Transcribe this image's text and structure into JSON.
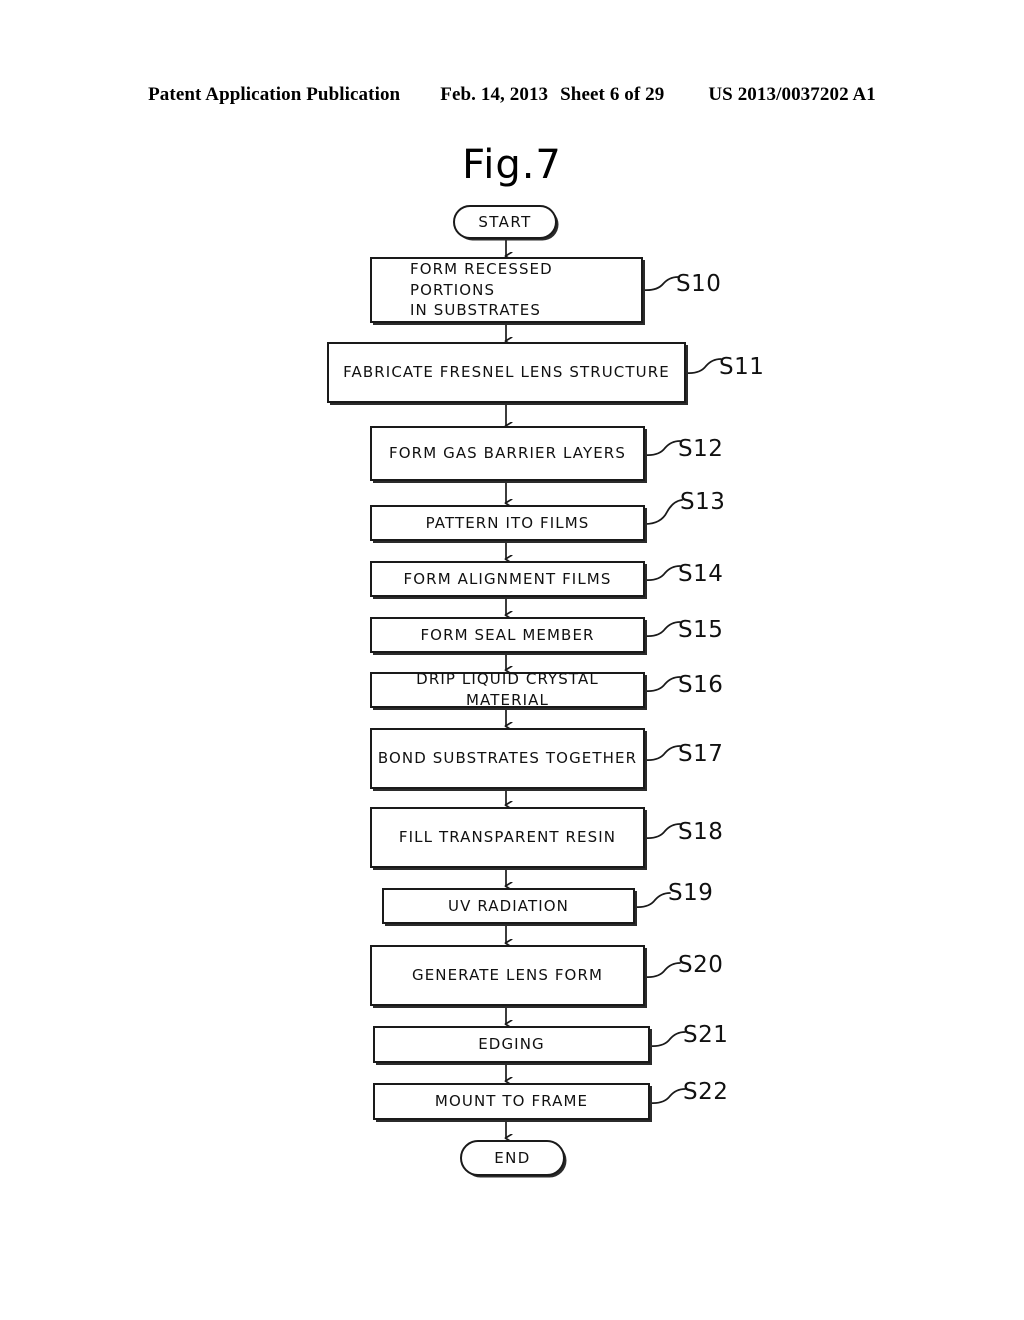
{
  "header": {
    "publication": "Patent Application Publication",
    "date": "Feb. 14, 2013",
    "sheet": "Sheet 6 of 29",
    "patent_number": "US 2013/0037202 A1"
  },
  "figure": {
    "title": "Fig.7"
  },
  "flowchart": {
    "start_label": "START",
    "end_label": "END",
    "steps": [
      {
        "ref": "S10",
        "text": "FORM RECESSED PORTIONS\nIN SUBSTRATES"
      },
      {
        "ref": "S11",
        "text": "FABRICATE FRESNEL LENS STRUCTURE"
      },
      {
        "ref": "S12",
        "text": "FORM GAS BARRIER LAYERS"
      },
      {
        "ref": "S13",
        "text": "PATTERN ITO FILMS"
      },
      {
        "ref": "S14",
        "text": "FORM ALIGNMENT FILMS"
      },
      {
        "ref": "S15",
        "text": "FORM SEAL MEMBER"
      },
      {
        "ref": "S16",
        "text": "DRIP LIQUID CRYSTAL MATERIAL"
      },
      {
        "ref": "S17",
        "text": "BOND SUBSTRATES TOGETHER"
      },
      {
        "ref": "S18",
        "text": "FILL TRANSPARENT RESIN"
      },
      {
        "ref": "S19",
        "text": "UV RADIATION"
      },
      {
        "ref": "S20",
        "text": "GENERATE LENS FORM"
      },
      {
        "ref": "S21",
        "text": "EDGING"
      },
      {
        "ref": "S22",
        "text": "MOUNT TO FRAME"
      }
    ]
  },
  "colors": {
    "ink": "#111111",
    "background": "#ffffff"
  }
}
